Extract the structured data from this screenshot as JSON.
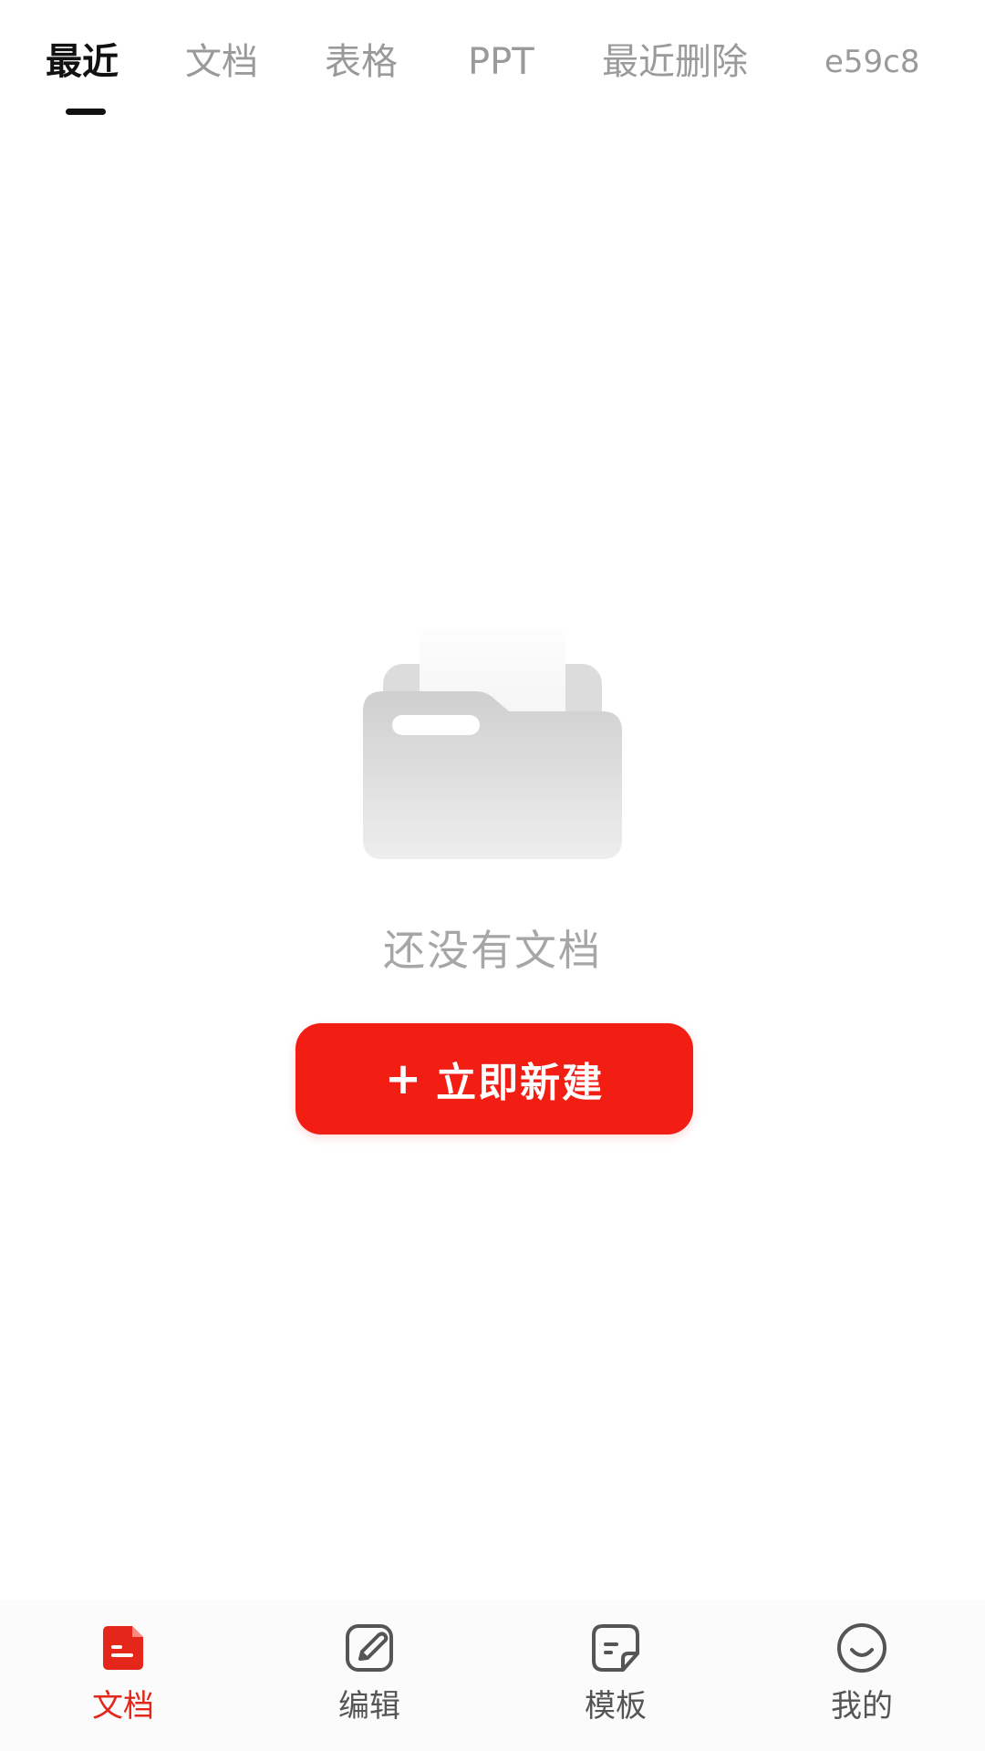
{
  "colors": {
    "accent": "#f21d13",
    "active_tab_text": "#111111",
    "inactive_tab_text": "#9a9a9a",
    "empty_text": "#a6a6a6"
  },
  "top_tabs": [
    {
      "label": "最近",
      "active": true
    },
    {
      "label": "文档",
      "active": false
    },
    {
      "label": "表格",
      "active": false
    },
    {
      "label": "PPT",
      "active": false
    },
    {
      "label": "最近删除",
      "active": false
    },
    {
      "label": "e59c8",
      "active": false
    }
  ],
  "empty_state": {
    "illustration_icon": "empty-folder-icon",
    "message": "还没有文档",
    "create_plus": "+",
    "create_label": "立即新建"
  },
  "bottom_nav": [
    {
      "label": "文档",
      "icon": "document-icon",
      "active": true
    },
    {
      "label": "编辑",
      "icon": "edit-pen-icon",
      "active": false
    },
    {
      "label": "模板",
      "icon": "template-icon",
      "active": false
    },
    {
      "label": "我的",
      "icon": "smiley-profile-icon",
      "active": false
    }
  ]
}
